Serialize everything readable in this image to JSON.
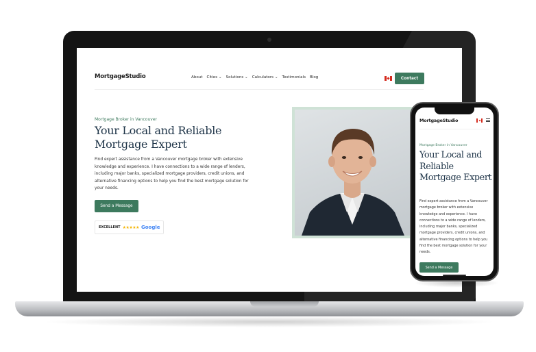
{
  "desktop": {
    "logo": "MortgageStudio",
    "nav": [
      {
        "label": "About"
      },
      {
        "label": "Cities ⌄"
      },
      {
        "label": "Solutions ⌄"
      },
      {
        "label": "Calculators ⌄"
      },
      {
        "label": "Testimonials"
      },
      {
        "label": "Blog"
      }
    ],
    "flag_icon": "canada-flag-icon",
    "contact_label": "Contact",
    "eyebrow": "Mortgage Broker in Vancouver",
    "title": "Your Local and Reliable Mortgage Expert",
    "body": "Find expert assistance from a Vancouver mortgage broker with extensive knowledge and experience. I have connections to a wide range of lenders, including major banks, specialized mortgage providers, credit unions, and alternative financing options to help you find the best mortgage solution for your needs.",
    "cta_label": "Send a Message",
    "review": {
      "rating_label": "EXCELLENT",
      "stars": "★★★★★",
      "provider": "Google"
    }
  },
  "mobile": {
    "logo": "MortgageStudio",
    "flag_icon": "canada-flag-icon",
    "menu_icon": "hamburger-menu-icon",
    "eyebrow": "Mortgage Broker in Vancouver",
    "title": "Your Local and Reliable Mortgage Expert",
    "body": "Find expert assistance from a Vancouver mortgage broker with extensive knowledge and experience. I have connections to a wide range of lenders, including major banks, specialized mortgage providers, credit unions, and alternative financing options to help you find the best mortgage solution for your needs.",
    "cta_label": "Send a Message"
  },
  "colors": {
    "brand_green": "#3d7a5e",
    "heading_navy": "#1d3347",
    "photo_frame": "#cfe2d6"
  }
}
